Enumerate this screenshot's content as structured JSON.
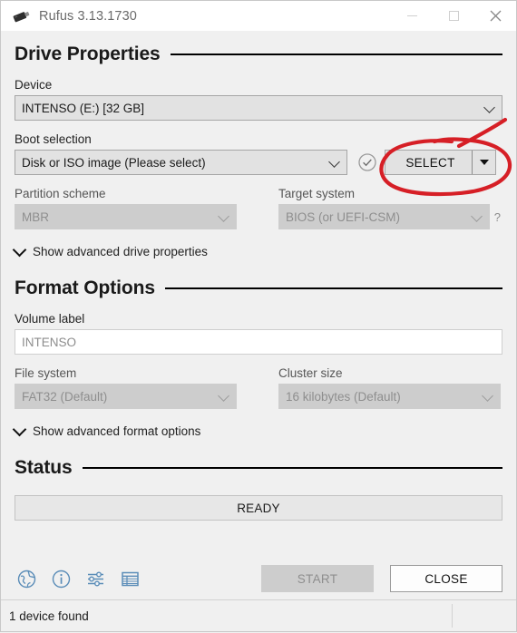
{
  "window": {
    "title": "Rufus 3.13.1730",
    "icon": "usb-drive-icon",
    "controls": {
      "minimize": "minimize-icon",
      "maximize": "maximize-icon",
      "close": "close-icon"
    }
  },
  "drive_properties": {
    "heading": "Drive Properties",
    "device": {
      "label": "Device",
      "value": "INTENSO (E:) [32 GB]"
    },
    "boot_selection": {
      "label": "Boot selection",
      "value": "Disk or ISO image (Please select)",
      "status_icon": "check-circle-icon",
      "select_button": "SELECT",
      "select_dropdown_icon": "caret-down-icon"
    },
    "partition_scheme": {
      "label": "Partition scheme",
      "value": "MBR",
      "disabled": true
    },
    "target_system": {
      "label": "Target system",
      "value": "BIOS (or UEFI-CSM)",
      "disabled": true,
      "help": "?"
    },
    "advanced_toggle": "Show advanced drive properties"
  },
  "format_options": {
    "heading": "Format Options",
    "volume_label": {
      "label": "Volume label",
      "value": "INTENSO"
    },
    "file_system": {
      "label": "File system",
      "value": "FAT32 (Default)",
      "disabled": true
    },
    "cluster_size": {
      "label": "Cluster size",
      "value": "16 kilobytes (Default)",
      "disabled": true
    },
    "advanced_toggle": "Show advanced format options"
  },
  "status": {
    "heading": "Status",
    "value": "READY"
  },
  "toolbar": {
    "icons": [
      {
        "name": "globe-icon",
        "tooltip": "Language"
      },
      {
        "name": "info-icon",
        "tooltip": "About"
      },
      {
        "name": "settings-sliders-icon",
        "tooltip": "Settings"
      },
      {
        "name": "log-icon",
        "tooltip": "Log"
      }
    ],
    "start_button": "START",
    "close_button": "CLOSE",
    "start_disabled": true
  },
  "statusbar": {
    "text": "1 device found"
  },
  "annotation": {
    "type": "hand-drawn-ellipse",
    "color": "#d61f26",
    "target": "SELECT"
  },
  "colors": {
    "window_bg": "#f0f0f0",
    "titlebar_bg": "#ffffff",
    "combo_bg": "#e2e2e2",
    "disabled_bg": "#cdcdcd",
    "accent_icon": "#5b8db8",
    "annotation_red": "#d61f26"
  }
}
